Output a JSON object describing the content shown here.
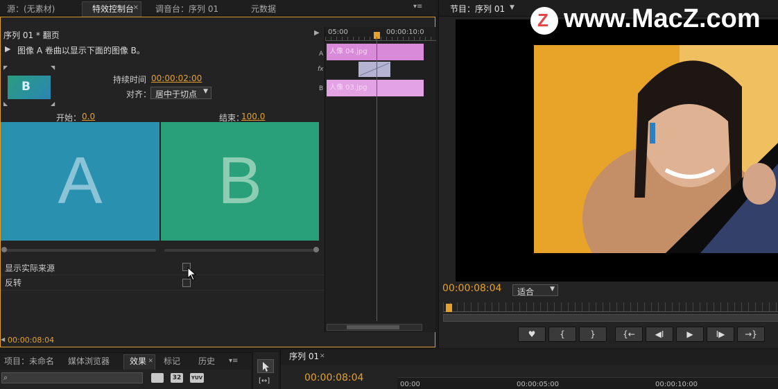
{
  "top_tabs": {
    "source": "源：(无素材)",
    "effect_controls": "特效控制台",
    "audio_mixer": "调音台：序列 01",
    "metadata": "元数据"
  },
  "effect_controls": {
    "sequence_title": "序列 01 * 翻页",
    "description": "图像 A 卷曲以显示下面的图像 B。",
    "duration_label": "持续时间",
    "duration_value": "00:00:02:00",
    "align_label": "对齐：",
    "align_value": "居中于切点",
    "start_label": "开始：",
    "start_value": "0.0",
    "end_label": "结束：",
    "end_value": "100.0",
    "letter_a": "A",
    "letter_b": "B",
    "show_actual_sources": "显示实际来源",
    "reverse": "反转",
    "bottom_timecode": "00:00:08:04"
  },
  "mini_timeline": {
    "ruler_start": "05:00",
    "ruler_end": "00:00:10:0",
    "track_a": "A",
    "track_fx": "fx",
    "track_b": "B",
    "clip_a": "人像 04.jpg",
    "clip_b": "人像 03.jpg"
  },
  "program": {
    "tab": "节目：序列 01",
    "timecode": "00:00:08:04",
    "fit": "适合"
  },
  "watermark": "www.MacZ.com",
  "bottom_panel": {
    "tabs": [
      "项目：未命名",
      "媒体浏览器",
      "效果",
      "标记",
      "历史"
    ],
    "icons": [
      "32",
      "YUV"
    ]
  },
  "sequence": {
    "tab": "序列 01",
    "timecode": "00:00:08:04",
    "ruler": [
      "00:00",
      "00:00:05:00",
      "00:00:10:00"
    ]
  },
  "transport": [
    "♥",
    "{",
    "}",
    "{←",
    "◀I",
    "▶",
    "I▶",
    "→}"
  ],
  "colors": {
    "accent_timecode": "#e5a12d",
    "clip_pink": "#d98ad9",
    "tile_blue": "#2a90b0",
    "tile_green": "#2aa07a",
    "active_border": "#e0a030"
  }
}
